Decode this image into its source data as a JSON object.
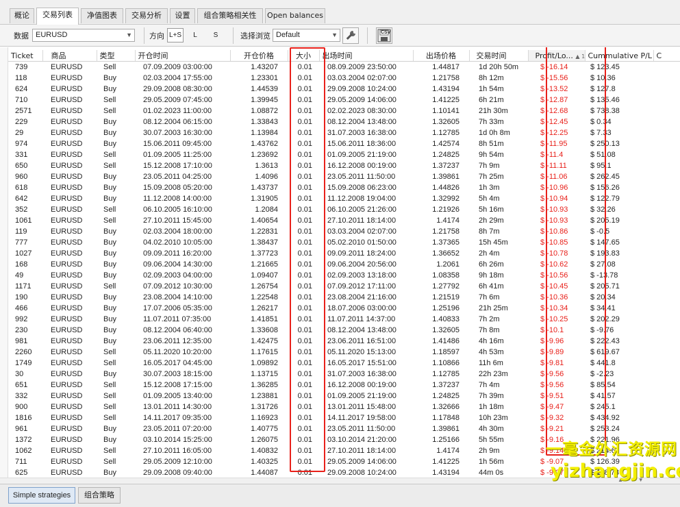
{
  "tabs": [
    {
      "label": "概论"
    },
    {
      "label": "交易列表"
    },
    {
      "label": "净值图表"
    },
    {
      "label": "交易分析"
    },
    {
      "label": "设置"
    },
    {
      "label": "组合策略相关性"
    },
    {
      "label": "Open balances"
    }
  ],
  "toolbar": {
    "data_label": "数据",
    "data_value": "EURUSD",
    "direction_label": "方向",
    "dir_ls": "L+S",
    "dir_l": "L",
    "dir_s": "S",
    "view_label": "选择浏览",
    "view_value": "Default",
    "csv_label": "CSV"
  },
  "columns": [
    "Ticket",
    "商品",
    "类型",
    "开仓时间",
    "开仓价格",
    "大小",
    "出场时间",
    "出场价格",
    "交易时间",
    "Profit/Lo...",
    "Cummulative P/L"
  ],
  "sort_indicator": "▲ 1",
  "rows": [
    [
      "739",
      "EURUSD",
      "Sell",
      "07.09.2009 03:00:00",
      "1.43207",
      "0.01",
      "08.09.2009 23:50:00",
      "1.44817",
      "1d 20h 50m",
      "$ -16.14",
      "$ 123.45"
    ],
    [
      "118",
      "EURUSD",
      "Buy",
      "02.03.2004 17:55:00",
      "1.23301",
      "0.01",
      "03.03.2004 02:07:00",
      "1.21758",
      "8h 12m",
      "$ -15.56",
      "$ 10.36"
    ],
    [
      "624",
      "EURUSD",
      "Buy",
      "29.09.2008 08:30:00",
      "1.44539",
      "0.01",
      "29.09.2008 10:24:00",
      "1.43194",
      "1h 54m",
      "$ -13.52",
      "$ 127.8"
    ],
    [
      "710",
      "EURUSD",
      "Sell",
      "29.05.2009 07:45:00",
      "1.39945",
      "0.01",
      "29.05.2009 14:06:00",
      "1.41225",
      "6h 21m",
      "$ -12.87",
      "$ 135.46"
    ],
    [
      "2571",
      "EURUSD",
      "Sell",
      "01.02.2023 11:00:00",
      "1.08872",
      "0.01",
      "02.02.2023 08:30:00",
      "1.10141",
      "21h 30m",
      "$ -12.68",
      "$ 738.38"
    ],
    [
      "229",
      "EURUSD",
      "Buy",
      "08.12.2004 06:15:00",
      "1.33843",
      "0.01",
      "08.12.2004 13:48:00",
      "1.32605",
      "7h 33m",
      "$ -12.45",
      "$ 0.34"
    ],
    [
      "29",
      "EURUSD",
      "Buy",
      "30.07.2003 16:30:00",
      "1.13984",
      "0.01",
      "31.07.2003 16:38:00",
      "1.12785",
      "1d 0h 8m",
      "$ -12.25",
      "$ 7.33"
    ],
    [
      "974",
      "EURUSD",
      "Buy",
      "15.06.2011 09:45:00",
      "1.43762",
      "0.01",
      "15.06.2011 18:36:00",
      "1.42574",
      "8h 51m",
      "$ -11.95",
      "$ 250.13"
    ],
    [
      "331",
      "EURUSD",
      "Sell",
      "01.09.2005 11:25:00",
      "1.23692",
      "0.01",
      "01.09.2005 21:19:00",
      "1.24825",
      "9h 54m",
      "$ -11.4",
      "$ 51.08"
    ],
    [
      "650",
      "EURUSD",
      "Sell",
      "15.12.2008 17:10:00",
      "1.3613",
      "0.01",
      "16.12.2008 00:19:00",
      "1.37237",
      "7h 9m",
      "$ -11.11",
      "$ 95.1"
    ],
    [
      "960",
      "EURUSD",
      "Buy",
      "23.05.2011 04:25:00",
      "1.4096",
      "0.01",
      "23.05.2011 11:50:00",
      "1.39861",
      "7h 25m",
      "$ -11.06",
      "$ 262.45"
    ],
    [
      "618",
      "EURUSD",
      "Buy",
      "15.09.2008 05:20:00",
      "1.43737",
      "0.01",
      "15.09.2008 06:23:00",
      "1.44826",
      "1h 3m",
      "$ -10.96",
      "$ 156.26"
    ],
    [
      "642",
      "EURUSD",
      "Buy",
      "11.12.2008 14:00:00",
      "1.31905",
      "0.01",
      "11.12.2008 19:04:00",
      "1.32992",
      "5h 4m",
      "$ -10.94",
      "$ 122.79"
    ],
    [
      "352",
      "EURUSD",
      "Sell",
      "06.10.2005 16:10:00",
      "1.2084",
      "0.01",
      "06.10.2005 21:26:00",
      "1.21926",
      "5h 16m",
      "$ -10.93",
      "$ 32.26"
    ],
    [
      "1061",
      "EURUSD",
      "Sell",
      "27.10.2011 15:45:00",
      "1.40654",
      "0.01",
      "27.10.2011 18:14:00",
      "1.4174",
      "2h 29m",
      "$ -10.93",
      "$ 205.19"
    ],
    [
      "119",
      "EURUSD",
      "Buy",
      "02.03.2004 18:00:00",
      "1.22831",
      "0.01",
      "03.03.2004 02:07:00",
      "1.21758",
      "8h 7m",
      "$ -10.86",
      "$ -0.5"
    ],
    [
      "777",
      "EURUSD",
      "Buy",
      "04.02.2010 10:05:00",
      "1.38437",
      "0.01",
      "05.02.2010 01:50:00",
      "1.37365",
      "15h 45m",
      "$ -10.85",
      "$ 147.65"
    ],
    [
      "1027",
      "EURUSD",
      "Buy",
      "09.09.2011 16:20:00",
      "1.37723",
      "0.01",
      "09.09.2011 18:24:00",
      "1.36652",
      "2h 4m",
      "$ -10.78",
      "$ 193.83"
    ],
    [
      "168",
      "EURUSD",
      "Buy",
      "09.06.2004 14:30:00",
      "1.21665",
      "0.01",
      "09.06.2004 20:56:00",
      "1.2061",
      "6h 26m",
      "$ -10.62",
      "$ 27.08"
    ],
    [
      "49",
      "EURUSD",
      "Buy",
      "02.09.2003 04:00:00",
      "1.09407",
      "0.01",
      "02.09.2003 13:18:00",
      "1.08358",
      "9h 18m",
      "$ -10.56",
      "$ -13.78"
    ],
    [
      "1171",
      "EURUSD",
      "Sell",
      "07.09.2012 10:30:00",
      "1.26754",
      "0.01",
      "07.09.2012 17:11:00",
      "1.27792",
      "6h 41m",
      "$ -10.45",
      "$ 205.71"
    ],
    [
      "190",
      "EURUSD",
      "Buy",
      "23.08.2004 14:10:00",
      "1.22548",
      "0.01",
      "23.08.2004 21:16:00",
      "1.21519",
      "7h 6m",
      "$ -10.36",
      "$ 20.34"
    ],
    [
      "466",
      "EURUSD",
      "Buy",
      "17.07.2006 05:35:00",
      "1.26217",
      "0.01",
      "18.07.2006 03:00:00",
      "1.25196",
      "21h 25m",
      "$ -10.34",
      "$ 34.41"
    ],
    [
      "992",
      "EURUSD",
      "Buy",
      "11.07.2011 07:35:00",
      "1.41851",
      "0.01",
      "11.07.2011 14:37:00",
      "1.40833",
      "7h 2m",
      "$ -10.25",
      "$ 202.29"
    ],
    [
      "230",
      "EURUSD",
      "Buy",
      "08.12.2004 06:40:00",
      "1.33608",
      "0.01",
      "08.12.2004 13:48:00",
      "1.32605",
      "7h 8m",
      "$ -10.1",
      "$ -9.76"
    ],
    [
      "981",
      "EURUSD",
      "Buy",
      "23.06.2011 12:35:00",
      "1.42475",
      "0.01",
      "23.06.2011 16:51:00",
      "1.41486",
      "4h 16m",
      "$ -9.96",
      "$ 222.43"
    ],
    [
      "2260",
      "EURUSD",
      "Sell",
      "05.11.2020 10:20:00",
      "1.17615",
      "0.01",
      "05.11.2020 15:13:00",
      "1.18597",
      "4h 53m",
      "$ -9.89",
      "$ 619.67"
    ],
    [
      "1749",
      "EURUSD",
      "Sell",
      "16.05.2017 04:45:00",
      "1.09892",
      "0.01",
      "16.05.2017 15:51:00",
      "1.10866",
      "11h 6m",
      "$ -9.81",
      "$ 441.8"
    ],
    [
      "30",
      "EURUSD",
      "Buy",
      "30.07.2003 18:15:00",
      "1.13715",
      "0.01",
      "31.07.2003 16:38:00",
      "1.12785",
      "22h 23m",
      "$ -9.56",
      "$ -2.23"
    ],
    [
      "651",
      "EURUSD",
      "Sell",
      "15.12.2008 17:15:00",
      "1.36285",
      "0.01",
      "16.12.2008 00:19:00",
      "1.37237",
      "7h 4m",
      "$ -9.56",
      "$ 85.54"
    ],
    [
      "332",
      "EURUSD",
      "Sell",
      "01.09.2005 13:40:00",
      "1.23881",
      "0.01",
      "01.09.2005 21:19:00",
      "1.24825",
      "7h 39m",
      "$ -9.51",
      "$ 41.57"
    ],
    [
      "900",
      "EURUSD",
      "Sell",
      "13.01.2011 14:30:00",
      "1.31726",
      "0.01",
      "13.01.2011 15:48:00",
      "1.32666",
      "1h 18m",
      "$ -9.47",
      "$ 245.1"
    ],
    [
      "1816",
      "EURUSD",
      "Sell",
      "14.11.2017 09:35:00",
      "1.16923",
      "0.01",
      "14.11.2017 19:58:00",
      "1.17848",
      "10h 23m",
      "$ -9.32",
      "$ 434.92"
    ],
    [
      "961",
      "EURUSD",
      "Buy",
      "23.05.2011 07:20:00",
      "1.40775",
      "0.01",
      "23.05.2011 11:50:00",
      "1.39861",
      "4h 30m",
      "$ -9.21",
      "$ 253.24"
    ],
    [
      "1372",
      "EURUSD",
      "Buy",
      "03.10.2014 15:25:00",
      "1.26075",
      "0.01",
      "03.10.2014 21:20:00",
      "1.25166",
      "5h 55m",
      "$ -9.16",
      "$ 221.96"
    ],
    [
      "1062",
      "EURUSD",
      "Sell",
      "27.10.2011 16:05:00",
      "1.40832",
      "0.01",
      "27.10.2011 18:14:00",
      "1.4174",
      "2h 9m",
      "$ -9.14",
      "$ 214.6"
    ],
    [
      "711",
      "EURUSD",
      "Sell",
      "29.05.2009 12:10:00",
      "1.40325",
      "0.01",
      "29.05.2009 14:06:00",
      "1.41225",
      "1h 56m",
      "$ -9.07",
      "$ 126.39"
    ],
    [
      "625",
      "EURUSD",
      "Buy",
      "29.09.2008 09:40:00",
      "1.44087",
      "0.01",
      "29.09.2008 10:24:00",
      "1.43194",
      "44m 0s",
      "$ -9.07",
      "$ 118.73"
    ]
  ],
  "bottom_tabs": [
    {
      "label": "Simple strategies"
    },
    {
      "label": "组合策略"
    }
  ],
  "watermark": {
    "line1": "一毫金外汇资源网",
    "line2": "yizhangjin.com"
  },
  "colors": {
    "loss": "#e8201a",
    "highlight": "#e8201a",
    "watermark": "#f3ef00"
  }
}
